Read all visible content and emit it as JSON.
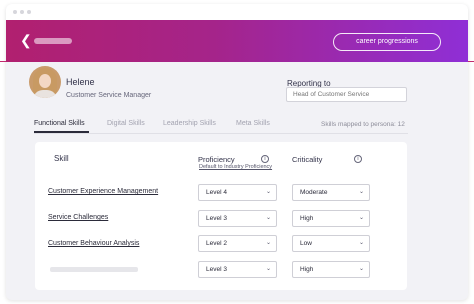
{
  "header": {
    "career_button_label": "career progressions",
    "back_icon": "chevron-left-icon",
    "colors": {
      "gradient_start": "#b1206f",
      "gradient_end": "#8f2fd6"
    }
  },
  "profile": {
    "name": "Helene",
    "role": "Customer Service Manager",
    "reporting_label": "Reporting to",
    "reporting_value": "Head of Customer Service"
  },
  "tabs": [
    {
      "label": "Functional Skills",
      "active": true
    },
    {
      "label": "Digital Skills",
      "active": false
    },
    {
      "label": "Leadership Skills",
      "active": false
    },
    {
      "label": "Meta Skills",
      "active": false
    }
  ],
  "skills_mapped_text": "Skills mapped to persona: 12",
  "table": {
    "col_skill": "Skill",
    "col_proficiency": "Proficiency",
    "proficiency_sublink": "Default to Industry Proficiency",
    "col_criticality": "Criticality",
    "rows": [
      {
        "skill": "Customer Experience Management",
        "proficiency": "Level 4",
        "criticality": "Moderate"
      },
      {
        "skill": "Service Challenges",
        "proficiency": "Level 3",
        "criticality": "High"
      },
      {
        "skill": "Customer Behaviour Analysis",
        "proficiency": "Level 2",
        "criticality": "Low"
      },
      {
        "skill": "",
        "proficiency": "Level 3",
        "criticality": "High"
      }
    ]
  }
}
